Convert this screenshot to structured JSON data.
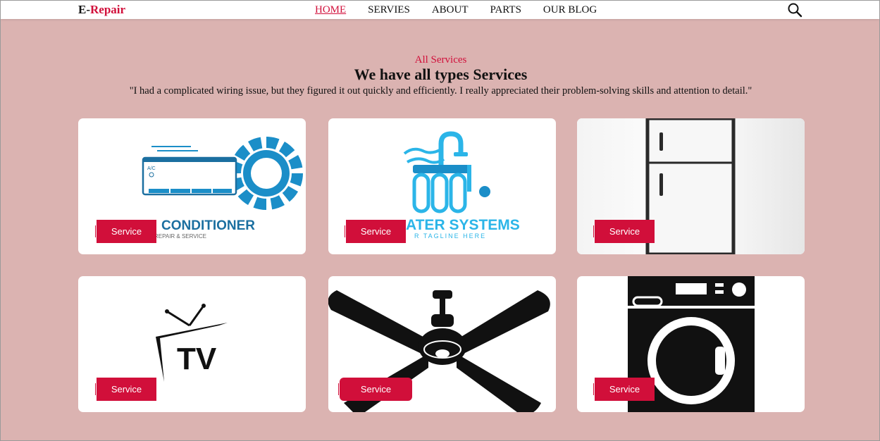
{
  "brand": {
    "first": "E-",
    "second": "Repair"
  },
  "nav": {
    "items": [
      {
        "label": "HOME"
      },
      {
        "label": "SERVIES"
      },
      {
        "label": "ABOUT"
      },
      {
        "label": "PARTS"
      },
      {
        "label": "OUR BLOG"
      }
    ]
  },
  "section": {
    "subtitle": "All Services",
    "title": "We have all types Services",
    "quote": "\"I had a complicated wiring issue, but they figured it out quickly and efficiently. I really appreciated their problem-solving skills and attention to detail.\""
  },
  "cards": [
    {
      "button": "Service",
      "logo_line1": "CONDITIONER",
      "logo_line2": "REPAIR & SERVICE",
      "badge": "A/C"
    },
    {
      "button": "Service",
      "logo_line1": "ATER SYSTEMS",
      "logo_line2": "R TAGLINE HERE"
    },
    {
      "button": "Service"
    },
    {
      "button": "Service",
      "logo_line1": "TV"
    },
    {
      "button": "Service"
    },
    {
      "button": "Service"
    }
  ],
  "colors": {
    "accent": "#d10f3a",
    "background": "#dbb3b1",
    "blue": "#1b8ec8",
    "cyan": "#2bb5e8"
  }
}
